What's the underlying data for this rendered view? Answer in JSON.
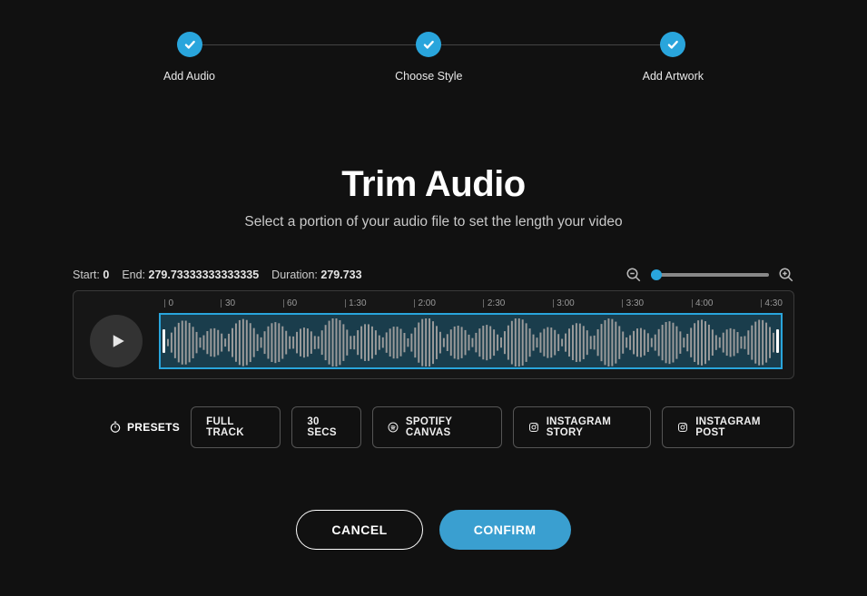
{
  "stepper": {
    "steps": [
      {
        "label": "Add Audio"
      },
      {
        "label": "Choose Style"
      },
      {
        "label": "Add Artwork"
      }
    ]
  },
  "page": {
    "title": "Trim Audio",
    "subtitle": "Select a portion of your audio file to set the length your video"
  },
  "trim": {
    "start_label": "Start:",
    "start_value": "0",
    "end_label": "End:",
    "end_value": "279.73333333333335",
    "duration_label": "Duration:",
    "duration_value": "279.733"
  },
  "ruler": {
    "ticks": [
      "0",
      "30",
      "60",
      "1:30",
      "2:00",
      "2:30",
      "3:00",
      "3:30",
      "4:00",
      "4:30"
    ]
  },
  "presets": {
    "label": "PRESETS",
    "items": {
      "full_track": "FULL TRACK",
      "thirty_secs": "30 SECS",
      "spotify_canvas": "SPOTIFY CANVAS",
      "instagram_story": "INSTAGRAM STORY",
      "instagram_post": "INSTAGRAM POST"
    }
  },
  "actions": {
    "cancel": "CANCEL",
    "confirm": "CONFIRM"
  }
}
